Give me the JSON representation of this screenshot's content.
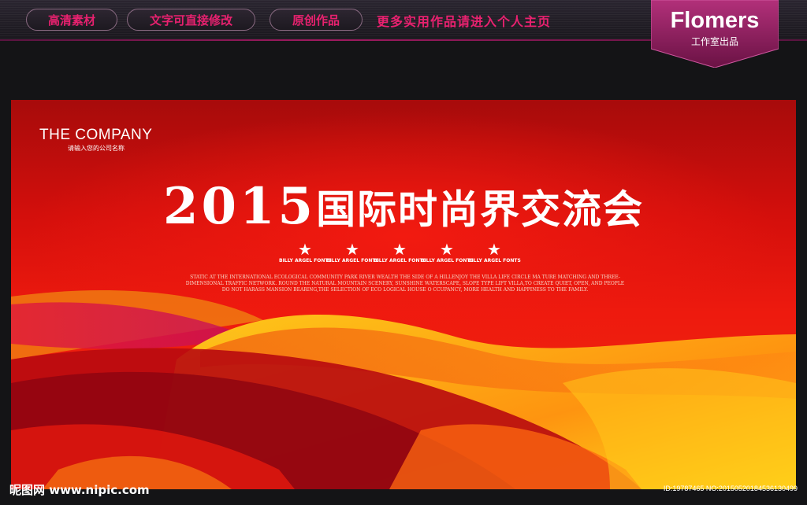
{
  "topbar": {
    "pills": [
      "高清素材",
      "文字可直接修改",
      "原创作品"
    ],
    "link": "更多实用作品请进入个人主页"
  },
  "brand": {
    "name": "Flomers",
    "sub": "工作室出品",
    "color": "#8a1d5a"
  },
  "poster": {
    "company": "THE COMPANY",
    "company_sub": "请输入您的公司名称",
    "title_year": "2015",
    "title_text": "国际时尚界交流会",
    "star_label": "BILLY ARGEL FONTS",
    "star_glyph": "A",
    "paragraph": "STATIC AT THE INTERNATIONAL ECOLOGICAL COMMUNITY PARK RIVER WEALTH THE SIDE OF A HILLENJOY THE VILLA LIFE CIRCLE MA TURE MATCHING AND THREE-DIMENSIONAL TRAFFIC NETWORK. ROUND THE NATURAL MOUNTAIN SCENERY, SUNSHINE WATERSCAPE, SLOPE TYPE LIFT VILLA,TO CREATE QUIET, OPEN, AND PEOPLE DO NOT HARASS MANSION BEARING,THE SELECTION OF ECO LOGICAL HOUSE O CCUPANCY, MORE HEALTH AND HAPPINESS TO THE FAMILY.",
    "accent": "#e8216f"
  },
  "footer": {
    "site": "昵图网 www.nipic.com",
    "id": "ID:19787465 NO:20150520184536130499"
  }
}
